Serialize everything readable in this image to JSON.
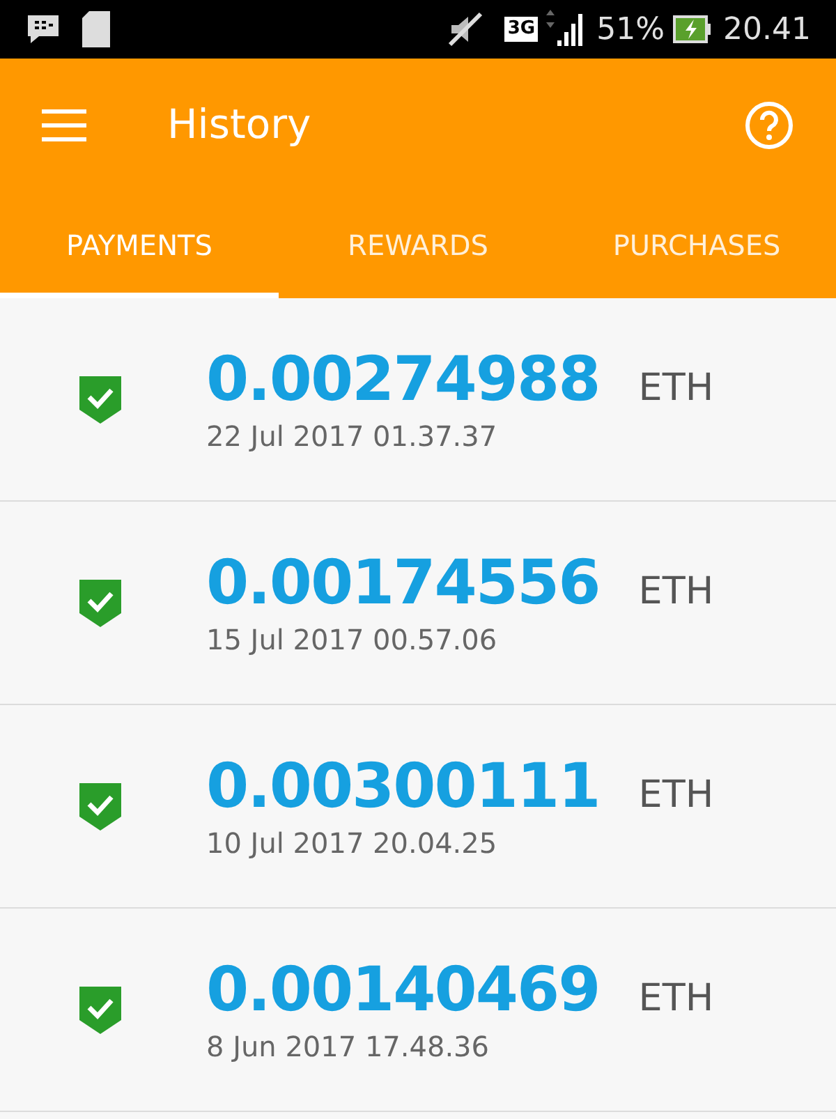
{
  "status_bar": {
    "network": "3G",
    "battery": "51%",
    "time": "20.41"
  },
  "app_bar": {
    "title": "History"
  },
  "tabs": [
    {
      "label": "PAYMENTS",
      "selected": true
    },
    {
      "label": "REWARDS",
      "selected": false
    },
    {
      "label": "PURCHASES",
      "selected": false
    }
  ],
  "payments": [
    {
      "amount": "0.00274988",
      "currency": "ETH",
      "date": "22 Jul 2017 01.37.37",
      "confirmed": true
    },
    {
      "amount": "0.00174556",
      "currency": "ETH",
      "date": "15 Jul 2017 00.57.06",
      "confirmed": true
    },
    {
      "amount": "0.00300111",
      "currency": "ETH",
      "date": "10 Jul 2017 20.04.25",
      "confirmed": true
    },
    {
      "amount": "0.00140469",
      "currency": "ETH",
      "date": "8 Jun 2017 17.48.36",
      "confirmed": true
    }
  ]
}
